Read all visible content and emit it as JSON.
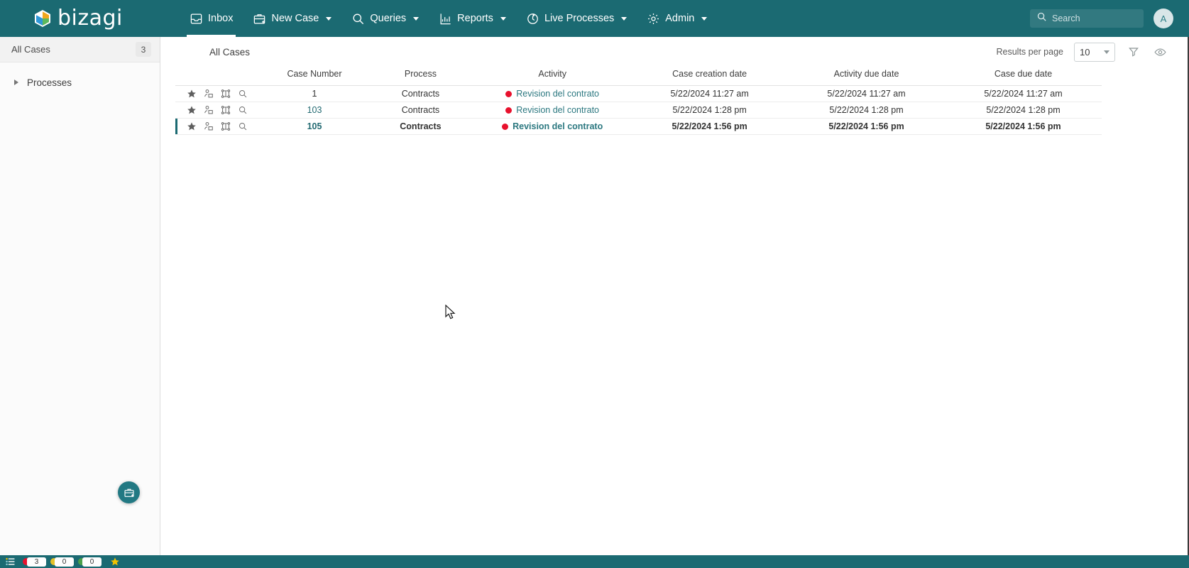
{
  "app": {
    "brand_name": "bizagi",
    "accent_color": "#1b6a72",
    "link_color": "#2c7880",
    "alert_color": "#e8112d"
  },
  "topnav": {
    "items": [
      {
        "label": "Inbox",
        "icon": "inbox-icon",
        "active": true,
        "has_caret": false
      },
      {
        "label": "New Case",
        "icon": "new-case-icon",
        "active": false,
        "has_caret": true
      },
      {
        "label": "Queries",
        "icon": "search-icon",
        "active": false,
        "has_caret": true
      },
      {
        "label": "Reports",
        "icon": "chart-icon",
        "active": false,
        "has_caret": true
      },
      {
        "label": "Live Processes",
        "icon": "live-processes-icon",
        "active": false,
        "has_caret": true
      },
      {
        "label": "Admin",
        "icon": "gear-icon",
        "active": false,
        "has_caret": true
      }
    ],
    "search": {
      "placeholder": "Search",
      "value": "",
      "icon": "search-icon"
    },
    "avatar": {
      "initial": "A"
    }
  },
  "sidebar": {
    "header": {
      "label": "All Cases",
      "count": "3"
    },
    "tree": [
      {
        "label": "Processes",
        "expanded": false
      }
    ],
    "fab": {
      "icon": "new-case-icon",
      "label": "New Case"
    }
  },
  "main": {
    "title": "All Cases",
    "results_per_page": {
      "label": "Results per page",
      "value": "10"
    },
    "toolbar": [
      {
        "name": "filter-icon",
        "label": "Filter"
      },
      {
        "name": "eye-icon",
        "label": "Show / hide columns"
      }
    ]
  },
  "table": {
    "columns": [
      "",
      "Case Number",
      "Process",
      "Activity",
      "Case creation date",
      "Activity due date",
      "Case due date"
    ],
    "row_actions": [
      "star-icon",
      "assign-user-icon",
      "workflow-icon",
      "search-icon"
    ],
    "rows": [
      {
        "case_number": "1",
        "case_number_is_link": false,
        "process": "Contracts",
        "activity": "Revision del contrato",
        "activity_status": "overdue",
        "case_creation_date": "5/22/2024 11:27 am",
        "activity_due_date": "5/22/2024 11:27 am",
        "case_due_date": "5/22/2024 11:27 am",
        "selected": false
      },
      {
        "case_number": "103",
        "case_number_is_link": true,
        "process": "Contracts",
        "activity": "Revision del contrato",
        "activity_status": "overdue",
        "case_creation_date": "5/22/2024 1:28 pm",
        "activity_due_date": "5/22/2024 1:28 pm",
        "case_due_date": "5/22/2024 1:28 pm",
        "selected": false
      },
      {
        "case_number": "105",
        "case_number_is_link": true,
        "process": "Contracts",
        "activity": "Revision del contrato",
        "activity_status": "overdue",
        "case_creation_date": "5/22/2024 1:56 pm",
        "activity_due_date": "5/22/2024 1:56 pm",
        "case_due_date": "5/22/2024 1:56 pm",
        "selected": true
      }
    ]
  },
  "statusbar": {
    "list_icon": "list-icon",
    "chips": [
      {
        "color": "#e8112d",
        "count": "3",
        "name": "overdue-count"
      },
      {
        "color": "#e3c229",
        "count": "0",
        "name": "at-risk-count"
      },
      {
        "color": "#4aa04a",
        "count": "0",
        "name": "on-time-count"
      }
    ],
    "star": {
      "name": "favorites-icon",
      "color": "#f2c200"
    }
  }
}
